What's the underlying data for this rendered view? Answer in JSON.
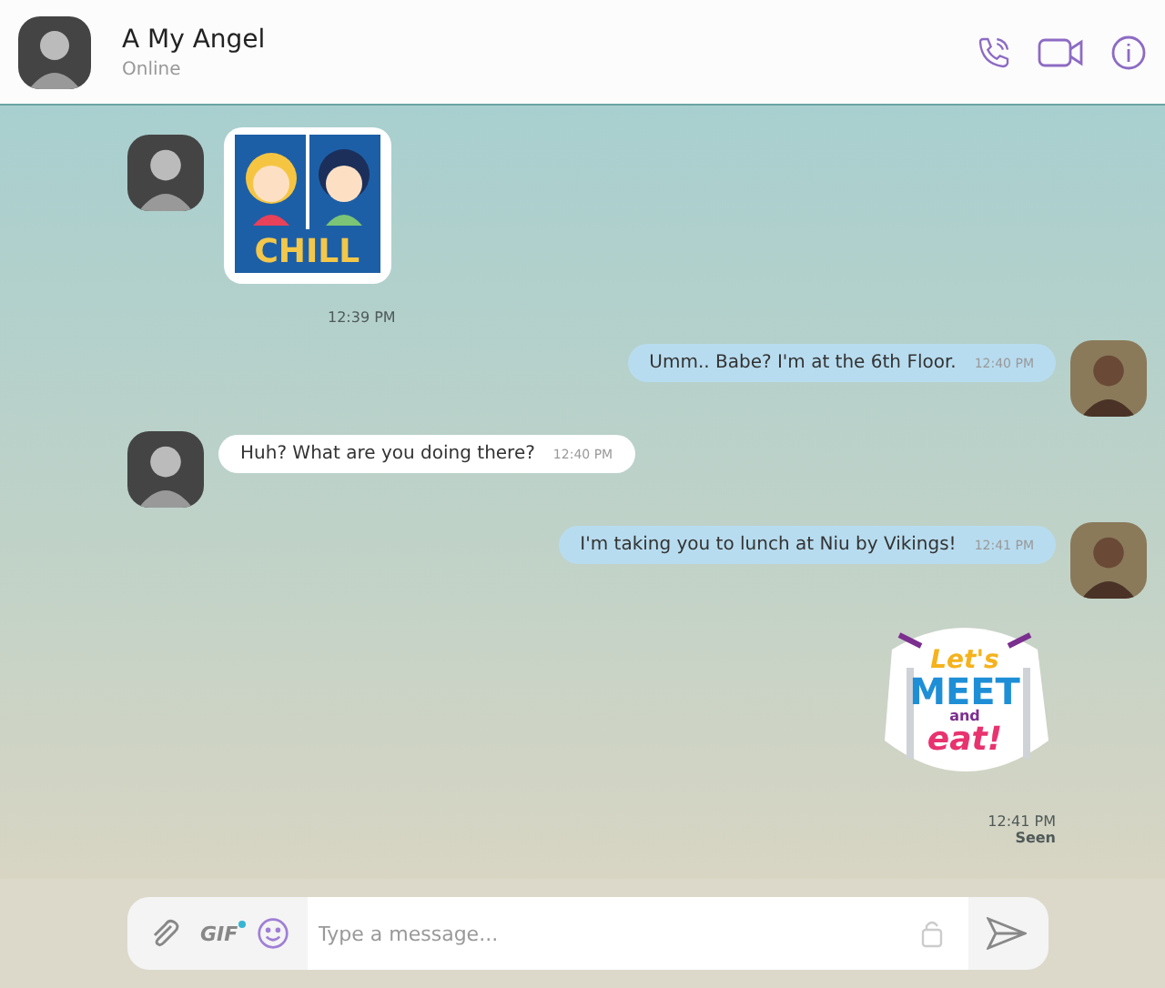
{
  "header": {
    "name": "A My Angel",
    "status": "Online"
  },
  "messages": [
    {
      "kind": "chill",
      "outgoing": false,
      "lines": [
        "CHILL"
      ],
      "time": "12:39 PM"
    },
    {
      "kind": "text",
      "outgoing": true,
      "text": "Umm.. Babe? I'm at the 6th Floor.",
      "time": "12:40 PM"
    },
    {
      "kind": "text",
      "outgoing": false,
      "text": "Huh? What are you doing there?",
      "time": "12:40 PM"
    },
    {
      "kind": "text",
      "outgoing": true,
      "text": "I'm taking you to lunch at Niu by Vikings!",
      "time": "12:41 PM"
    },
    {
      "kind": "meet",
      "outgoing": true,
      "lines": [
        "Let's",
        "MEET",
        "and",
        "eat!"
      ],
      "time": "12:41 PM",
      "status": "Seen"
    }
  ],
  "composer": {
    "gif": "GIF",
    "placeholder": "Type a message..."
  }
}
